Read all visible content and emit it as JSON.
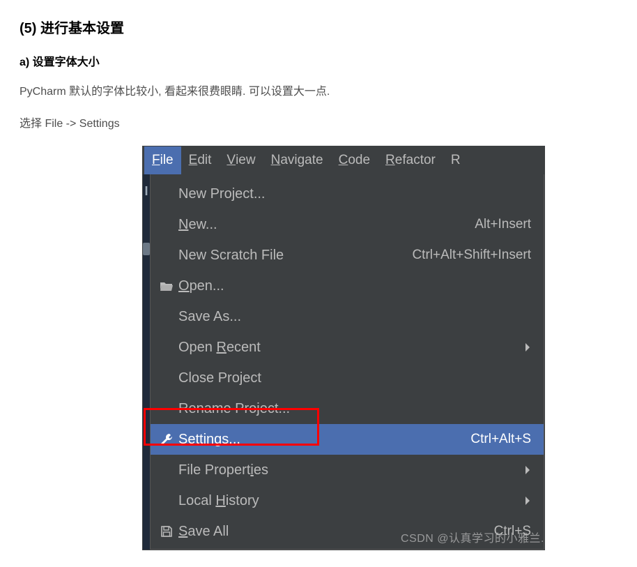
{
  "doc": {
    "heading5": "(5) 进行基本设置",
    "heading6": "a) 设置字体大小",
    "para1": "PyCharm 默认的字体比较小, 看起来很费眼睛. 可以设置大一点.",
    "para2": "选择 File -> Settings"
  },
  "menubar": {
    "items": [
      {
        "pre": "",
        "mn": "F",
        "post": "ile",
        "active": true
      },
      {
        "pre": "",
        "mn": "E",
        "post": "dit"
      },
      {
        "pre": "",
        "mn": "V",
        "post": "iew"
      },
      {
        "pre": "",
        "mn": "N",
        "post": "avigate"
      },
      {
        "pre": "",
        "mn": "C",
        "post": "ode"
      },
      {
        "pre": "",
        "mn": "R",
        "post": "efactor"
      },
      {
        "pre": "R",
        "mn": "",
        "post": ""
      }
    ]
  },
  "menu": {
    "rows": [
      {
        "label_pre": "New Project...",
        "shortcut": "",
        "icon": "",
        "submenu": false
      },
      {
        "label_pre": "",
        "mn": "N",
        "label_post": "ew...",
        "shortcut": "Alt+Insert",
        "icon": "",
        "submenu": false
      },
      {
        "label_pre": "New Scratch File",
        "shortcut": "Ctrl+Alt+Shift+Insert",
        "icon": "",
        "submenu": false
      },
      {
        "label_pre": "",
        "mn": "O",
        "label_post": "pen...",
        "shortcut": "",
        "icon": "folder-open-icon",
        "submenu": false
      },
      {
        "label_pre": "Save As...",
        "shortcut": "",
        "icon": "",
        "submenu": false
      },
      {
        "label_pre": "Open ",
        "mn": "R",
        "label_post": "ecent",
        "shortcut": "",
        "icon": "",
        "submenu": true
      },
      {
        "label_pre": "Close Pro",
        "mn": "j",
        "label_post": "ect",
        "shortcut": "",
        "icon": "",
        "submenu": false
      },
      {
        "label_pre": "Rename Project...",
        "shortcut": "",
        "icon": "",
        "submenu": false
      },
      {
        "label_pre": "Se",
        "mn": "t",
        "label_post": "tings...",
        "shortcut": "Ctrl+Alt+S",
        "icon": "wrench-icon",
        "submenu": false,
        "highlight": true
      },
      {
        "label_pre": "File Propert",
        "mn": "i",
        "label_post": "es",
        "shortcut": "",
        "icon": "",
        "submenu": true
      },
      {
        "label_pre": "Local ",
        "mn": "H",
        "label_post": "istory",
        "shortcut": "",
        "icon": "",
        "submenu": true
      },
      {
        "label_pre": "",
        "mn": "S",
        "label_post": "ave All",
        "shortcut": "Ctrl+S",
        "icon": "save-icon",
        "submenu": false
      }
    ]
  },
  "watermark": "CSDN @认真学习的小雅兰."
}
